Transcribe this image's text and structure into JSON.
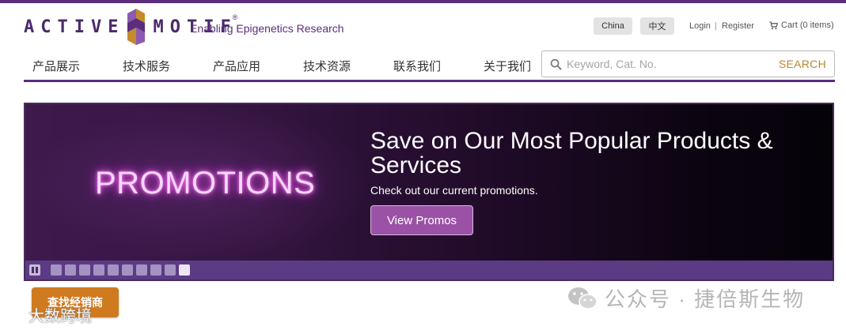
{
  "brand": {
    "logo_left": "ACTIVE",
    "logo_right": "MOTIF",
    "logo_reg": "®",
    "tagline": "Enabling Epigenetics Research",
    "colors": {
      "primary": "#5b2d7c",
      "accent_gold": "#b8892d",
      "button_purple": "#9b52a6",
      "dealer_orange": "#d07a20"
    }
  },
  "header": {
    "lang_china": "China",
    "lang_chinese": "中文",
    "login": "Login",
    "separator": "|",
    "register": "Register",
    "cart": "Cart (0 items)",
    "cart_icon": "cart-icon"
  },
  "nav": {
    "items": [
      {
        "label": "产品展示"
      },
      {
        "label": "技术服务"
      },
      {
        "label": "产品应用"
      },
      {
        "label": "技术资源"
      },
      {
        "label": "联系我们"
      },
      {
        "label": "关于我们"
      }
    ]
  },
  "search": {
    "placeholder": "Keyword, Cat. No.",
    "value": "",
    "button": "SEARCH",
    "icon": "search-icon"
  },
  "banner": {
    "promo_word": "PROMOTIONS",
    "headline": "Save on Our Most Popular Products & Services",
    "subline": "Check out our current promotions.",
    "cta": "View Promos",
    "slide_count": 10,
    "active_slide": 10
  },
  "floating": {
    "dealer_button": "查找经销商"
  },
  "watermarks": {
    "left": "大数跨境",
    "right": "公众号 · 捷倍斯生物"
  }
}
